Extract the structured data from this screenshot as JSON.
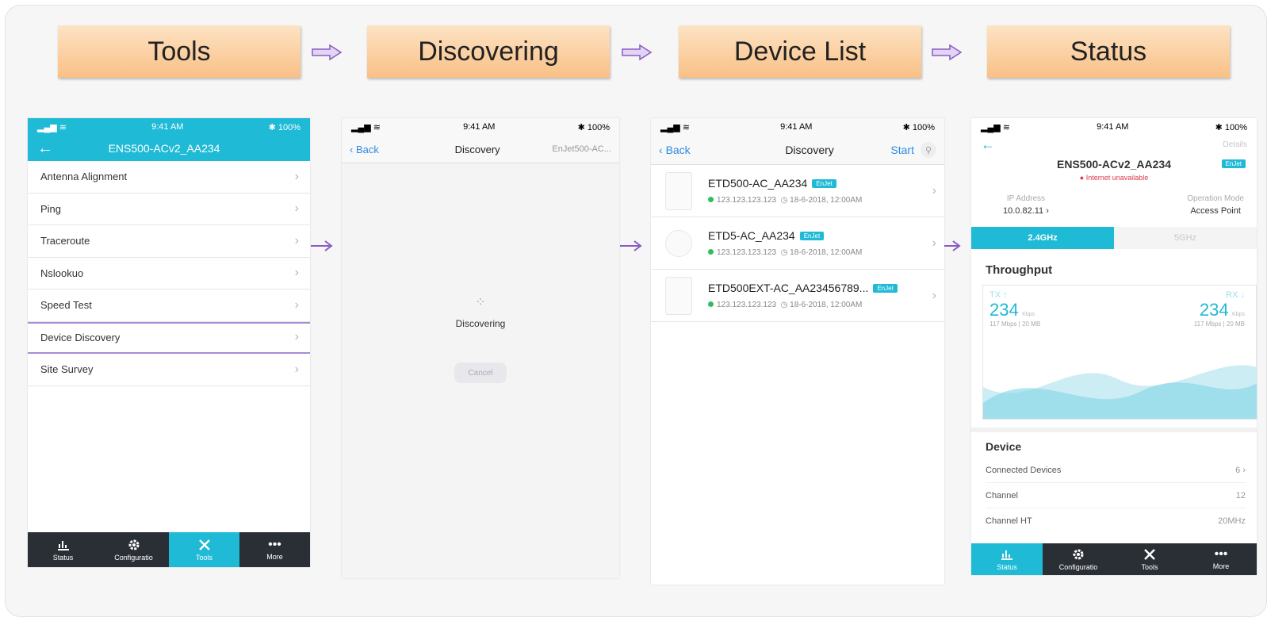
{
  "steps": [
    "Tools",
    "Discovering",
    "Device List",
    "Status"
  ],
  "colors": {
    "accent": "#1fbad6",
    "step_fill": "#f9c086",
    "arrow": "#8a5cc0",
    "online": "#2fbf5a",
    "error": "#e0384b"
  },
  "status_bar": {
    "signal_icon": "signal-wifi-icon",
    "time": "9:41 AM",
    "battery": "✱ 100%"
  },
  "tools_screen": {
    "title": "ENS500-ACv2_AA234",
    "back_icon": "back-arrow-icon",
    "items": [
      "Antenna Alignment",
      "Ping",
      "Traceroute",
      "Nslookuo",
      "Speed Test",
      "Device Discovery",
      "Site Survey"
    ],
    "highlighted_item": "Device Discovery"
  },
  "discovery_screen": {
    "back_label": "Back",
    "title": "Discovery",
    "right_label": "EnJet500-AC...",
    "status_text": "Discovering",
    "cancel_label": "Cancel"
  },
  "device_list_screen": {
    "back_label": "Back",
    "title": "Discovery",
    "start_label": "Start",
    "devices": [
      {
        "name": "ETD500-AC_AA234",
        "badge": "EnJet",
        "ip": "123.123.123.123",
        "time": "◷ 18-6-2018, 12:00AM"
      },
      {
        "name": "ETD5-AC_AA234",
        "badge": "EnJet",
        "ip": "123.123.123.123",
        "time": "◷ 18-6-2018, 12:00AM"
      },
      {
        "name": "ETD500EXT-AC_AA23456789...",
        "badge": "EnJet",
        "ip": "123.123.123.123",
        "time": "◷ 18-6-2018, 12:00AM"
      }
    ]
  },
  "status_screen": {
    "details_label": "Details",
    "device_name": "ENS500-ACv2_AA234",
    "badge": "EnJet",
    "internet_status": "Internet unavailable",
    "ip_label": "IP Address",
    "ip_value": "10.0.82.11",
    "mode_label": "Operation Mode",
    "mode_value": "Access Point",
    "bands": [
      "2.4GHz",
      "5GHz"
    ],
    "active_band": "2.4GHz",
    "throughput_title": "Throughput",
    "tx_label": "TX ↑",
    "tx_value": "234",
    "tx_unit": "Kbps",
    "tx_sub": "117 Mbps | 20 MB",
    "rx_label": "RX ↓",
    "rx_value": "234",
    "rx_unit": "Kbps",
    "rx_sub": "117 Mbps | 20 MB",
    "device_title": "Device",
    "rows": [
      {
        "label": "Connected Devices",
        "value": "6"
      },
      {
        "label": "Channel",
        "value": "12"
      },
      {
        "label": "Channel HT",
        "value": "20MHz"
      }
    ]
  },
  "tabbar": [
    {
      "label": "Status",
      "icon": "status-chart-icon"
    },
    {
      "label": "Configuratio",
      "icon": "gear-icon"
    },
    {
      "label": "Tools",
      "icon": "tools-icon"
    },
    {
      "label": "More",
      "icon": "more-dots-icon"
    }
  ]
}
